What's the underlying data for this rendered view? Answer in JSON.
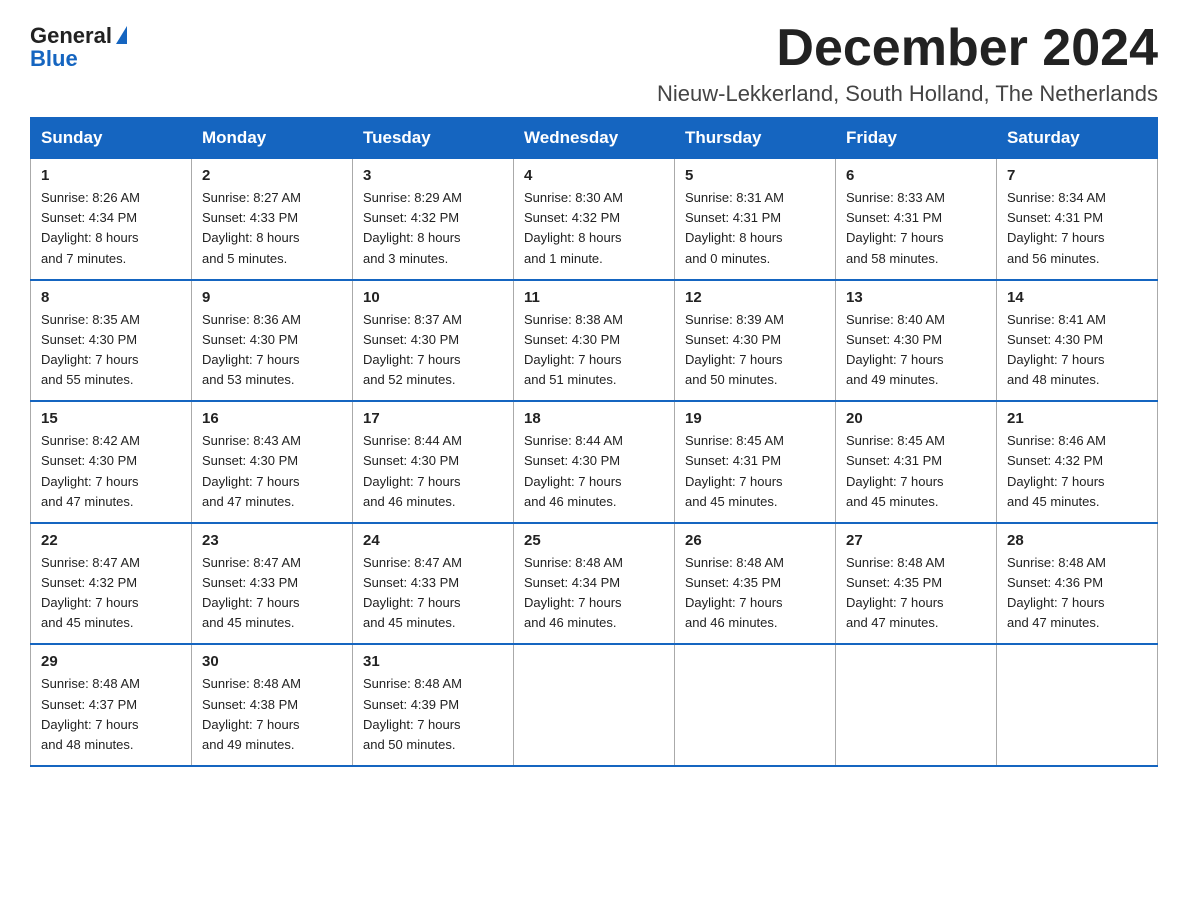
{
  "header": {
    "logo_line1": "General",
    "logo_line2": "Blue",
    "month_title": "December 2024",
    "location": "Nieuw-Lekkerland, South Holland, The Netherlands"
  },
  "days_of_week": [
    "Sunday",
    "Monday",
    "Tuesday",
    "Wednesday",
    "Thursday",
    "Friday",
    "Saturday"
  ],
  "weeks": [
    [
      {
        "day": "1",
        "sunrise": "8:26 AM",
        "sunset": "4:34 PM",
        "daylight": "8 hours and 7 minutes."
      },
      {
        "day": "2",
        "sunrise": "8:27 AM",
        "sunset": "4:33 PM",
        "daylight": "8 hours and 5 minutes."
      },
      {
        "day": "3",
        "sunrise": "8:29 AM",
        "sunset": "4:32 PM",
        "daylight": "8 hours and 3 minutes."
      },
      {
        "day": "4",
        "sunrise": "8:30 AM",
        "sunset": "4:32 PM",
        "daylight": "8 hours and 1 minute."
      },
      {
        "day": "5",
        "sunrise": "8:31 AM",
        "sunset": "4:31 PM",
        "daylight": "8 hours and 0 minutes."
      },
      {
        "day": "6",
        "sunrise": "8:33 AM",
        "sunset": "4:31 PM",
        "daylight": "7 hours and 58 minutes."
      },
      {
        "day": "7",
        "sunrise": "8:34 AM",
        "sunset": "4:31 PM",
        "daylight": "7 hours and 56 minutes."
      }
    ],
    [
      {
        "day": "8",
        "sunrise": "8:35 AM",
        "sunset": "4:30 PM",
        "daylight": "7 hours and 55 minutes."
      },
      {
        "day": "9",
        "sunrise": "8:36 AM",
        "sunset": "4:30 PM",
        "daylight": "7 hours and 53 minutes."
      },
      {
        "day": "10",
        "sunrise": "8:37 AM",
        "sunset": "4:30 PM",
        "daylight": "7 hours and 52 minutes."
      },
      {
        "day": "11",
        "sunrise": "8:38 AM",
        "sunset": "4:30 PM",
        "daylight": "7 hours and 51 minutes."
      },
      {
        "day": "12",
        "sunrise": "8:39 AM",
        "sunset": "4:30 PM",
        "daylight": "7 hours and 50 minutes."
      },
      {
        "day": "13",
        "sunrise": "8:40 AM",
        "sunset": "4:30 PM",
        "daylight": "7 hours and 49 minutes."
      },
      {
        "day": "14",
        "sunrise": "8:41 AM",
        "sunset": "4:30 PM",
        "daylight": "7 hours and 48 minutes."
      }
    ],
    [
      {
        "day": "15",
        "sunrise": "8:42 AM",
        "sunset": "4:30 PM",
        "daylight": "7 hours and 47 minutes."
      },
      {
        "day": "16",
        "sunrise": "8:43 AM",
        "sunset": "4:30 PM",
        "daylight": "7 hours and 47 minutes."
      },
      {
        "day": "17",
        "sunrise": "8:44 AM",
        "sunset": "4:30 PM",
        "daylight": "7 hours and 46 minutes."
      },
      {
        "day": "18",
        "sunrise": "8:44 AM",
        "sunset": "4:30 PM",
        "daylight": "7 hours and 46 minutes."
      },
      {
        "day": "19",
        "sunrise": "8:45 AM",
        "sunset": "4:31 PM",
        "daylight": "7 hours and 45 minutes."
      },
      {
        "day": "20",
        "sunrise": "8:45 AM",
        "sunset": "4:31 PM",
        "daylight": "7 hours and 45 minutes."
      },
      {
        "day": "21",
        "sunrise": "8:46 AM",
        "sunset": "4:32 PM",
        "daylight": "7 hours and 45 minutes."
      }
    ],
    [
      {
        "day": "22",
        "sunrise": "8:47 AM",
        "sunset": "4:32 PM",
        "daylight": "7 hours and 45 minutes."
      },
      {
        "day": "23",
        "sunrise": "8:47 AM",
        "sunset": "4:33 PM",
        "daylight": "7 hours and 45 minutes."
      },
      {
        "day": "24",
        "sunrise": "8:47 AM",
        "sunset": "4:33 PM",
        "daylight": "7 hours and 45 minutes."
      },
      {
        "day": "25",
        "sunrise": "8:48 AM",
        "sunset": "4:34 PM",
        "daylight": "7 hours and 46 minutes."
      },
      {
        "day": "26",
        "sunrise": "8:48 AM",
        "sunset": "4:35 PM",
        "daylight": "7 hours and 46 minutes."
      },
      {
        "day": "27",
        "sunrise": "8:48 AM",
        "sunset": "4:35 PM",
        "daylight": "7 hours and 47 minutes."
      },
      {
        "day": "28",
        "sunrise": "8:48 AM",
        "sunset": "4:36 PM",
        "daylight": "7 hours and 47 minutes."
      }
    ],
    [
      {
        "day": "29",
        "sunrise": "8:48 AM",
        "sunset": "4:37 PM",
        "daylight": "7 hours and 48 minutes."
      },
      {
        "day": "30",
        "sunrise": "8:48 AM",
        "sunset": "4:38 PM",
        "daylight": "7 hours and 49 minutes."
      },
      {
        "day": "31",
        "sunrise": "8:48 AM",
        "sunset": "4:39 PM",
        "daylight": "7 hours and 50 minutes."
      },
      null,
      null,
      null,
      null
    ]
  ],
  "labels": {
    "sunrise": "Sunrise:",
    "sunset": "Sunset:",
    "daylight": "Daylight:"
  }
}
